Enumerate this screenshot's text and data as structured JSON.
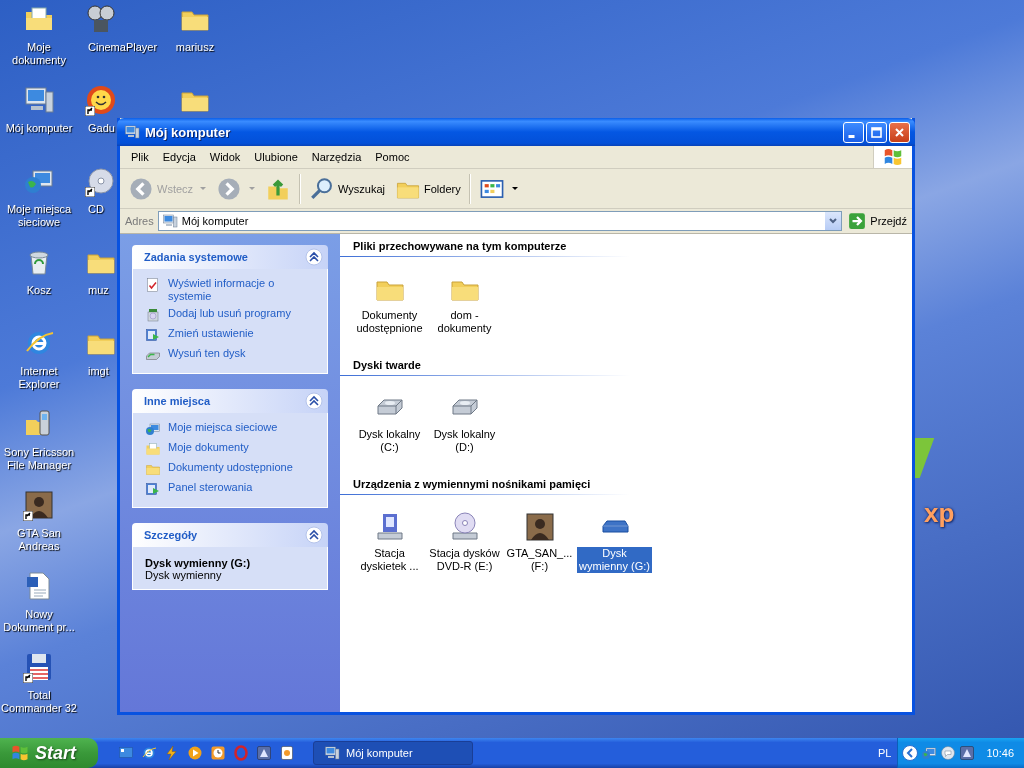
{
  "desktop": {
    "wallpaper": {
      "logo_text": "xp"
    },
    "columns": [
      [
        {
          "label": "Moje dokumenty",
          "kind": "documents",
          "shortcut": false
        },
        {
          "label": "Mój komputer",
          "kind": "computer",
          "shortcut": false
        },
        {
          "label": "Moje miejsca sieciowe",
          "kind": "network",
          "shortcut": false
        },
        {
          "label": "Kosz",
          "kind": "recycle",
          "shortcut": false
        },
        {
          "label": "Internet Explorer",
          "kind": "ie",
          "shortcut": false
        },
        {
          "label": "Sony Ericsson File Manager",
          "kind": "phone",
          "shortcut": false
        },
        {
          "label": "GTA San Andreas",
          "kind": "photo",
          "shortcut": true
        },
        {
          "label": "Nowy Dokument pr...",
          "kind": "word",
          "shortcut": false
        },
        {
          "label": "Total Commander 32",
          "kind": "floppy",
          "shortcut": true
        }
      ],
      [
        {
          "label": "CinemaPlayer",
          "kind": "film",
          "shortcut": false
        },
        {
          "label": "Gadu",
          "kind": "sun",
          "shortcut": true
        },
        {
          "label": "CD",
          "kind": "cd",
          "shortcut": true
        },
        {
          "label": "muz",
          "kind": "folder",
          "shortcut": false
        },
        {
          "label": "imgt",
          "kind": "folder",
          "shortcut": false
        }
      ],
      [
        {
          "label": "mariusz",
          "kind": "folder",
          "shortcut": false
        },
        {
          "kind": "folder",
          "shortcut": false
        }
      ]
    ]
  },
  "window": {
    "title": "Mój komputer",
    "menu": [
      "Plik",
      "Edycja",
      "Widok",
      "Ulubione",
      "Narzędzia",
      "Pomoc"
    ],
    "toolbar": [
      {
        "kind": "back",
        "label": "Wstecz",
        "disabled": true
      },
      {
        "kind": "forward",
        "disabled": true
      },
      {
        "kind": "up",
        "disabled": false
      },
      {
        "kind": "search",
        "label": "Wyszukaj",
        "disabled": false
      },
      {
        "kind": "folders",
        "label": "Foldery",
        "disabled": false
      },
      {
        "kind": "views",
        "disabled": false
      }
    ],
    "address": {
      "label": "Adres",
      "value": "Mój komputer",
      "go": "Przejdź"
    },
    "task_groups": [
      {
        "title": "Zadania systemowe",
        "expanded": true,
        "items": [
          {
            "label": "Wyświetl informacje o systemie",
            "kind": "info"
          },
          {
            "label": "Dodaj lub usuń programy",
            "kind": "addremove"
          },
          {
            "label": "Zmień ustawienie",
            "kind": "settings"
          },
          {
            "label": "Wysuń ten dysk",
            "kind": "eject"
          }
        ]
      },
      {
        "title": "Inne miejsca",
        "expanded": true,
        "items": [
          {
            "label": "Moje miejsca sieciowe",
            "kind": "network"
          },
          {
            "label": "Moje dokumenty",
            "kind": "documents"
          },
          {
            "label": "Dokumenty udostępnione",
            "kind": "folder"
          },
          {
            "label": "Panel sterowania",
            "kind": "settings"
          }
        ]
      }
    ],
    "details": {
      "title": "Szczegóły",
      "expanded": true,
      "name": "Dysk wymienny (G:)",
      "type": "Dysk wymienny"
    },
    "sections": [
      {
        "title": "Pliki przechowywane na tym komputerze",
        "items": [
          {
            "label": "Dokumenty udostępnione",
            "kind": "folder",
            "selected": false
          },
          {
            "label": "dom - dokumenty",
            "kind": "folder",
            "selected": false
          }
        ]
      },
      {
        "title": "Dyski twarde",
        "items": [
          {
            "label": "Dysk lokalny (C:)",
            "kind": "hdd",
            "selected": false
          },
          {
            "label": "Dysk lokalny (D:)",
            "kind": "hdd",
            "selected": false
          }
        ]
      },
      {
        "title": "Urządzenia z wymiennymi nośnikami pamięci",
        "items": [
          {
            "label": "Stacja dyskietek ...",
            "kind": "floppydrive",
            "selected": false
          },
          {
            "label": "Stacja dysków DVD-R (E:)",
            "kind": "dvd",
            "selected": false
          },
          {
            "label": "GTA_SAN_... (F:)",
            "kind": "photo",
            "selected": false
          },
          {
            "label": "Dysk wymienny (G:)",
            "kind": "removable",
            "selected": true
          }
        ]
      }
    ]
  },
  "taskbar": {
    "start": "Start",
    "quick_launch": [
      {
        "kind": "desktop"
      },
      {
        "kind": "ie"
      },
      {
        "kind": "winamp"
      },
      {
        "kind": "media"
      },
      {
        "kind": "clock"
      },
      {
        "kind": "opera"
      },
      {
        "kind": "app"
      },
      {
        "kind": "note"
      }
    ],
    "tasks": [
      {
        "label": "Mój komputer",
        "selected": true
      }
    ],
    "tray": {
      "language": "PL",
      "icons": [
        {
          "kind": "network"
        },
        {
          "kind": "speech"
        },
        {
          "kind": "app"
        }
      ],
      "clock": "10:46"
    }
  }
}
